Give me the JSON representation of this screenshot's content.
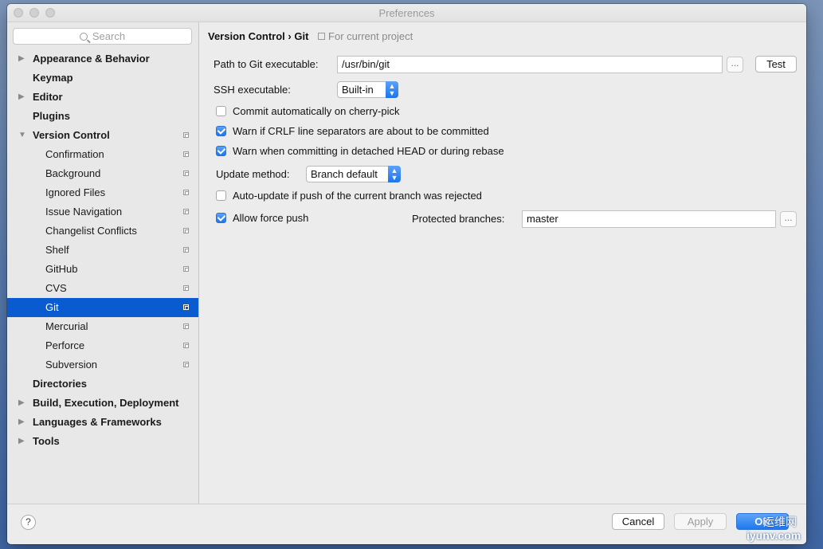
{
  "window": {
    "title": "Preferences"
  },
  "sidebar": {
    "search_placeholder": "Search",
    "items": [
      {
        "label": "Appearance & Behavior",
        "level": 0,
        "arrow": "▶"
      },
      {
        "label": "Keymap",
        "level": 0,
        "arrow": ""
      },
      {
        "label": "Editor",
        "level": 0,
        "arrow": "▶"
      },
      {
        "label": "Plugins",
        "level": 0,
        "arrow": ""
      },
      {
        "label": "Version Control",
        "level": 0,
        "arrow": "▼"
      },
      {
        "label": "Confirmation",
        "level": 1
      },
      {
        "label": "Background",
        "level": 1
      },
      {
        "label": "Ignored Files",
        "level": 1
      },
      {
        "label": "Issue Navigation",
        "level": 1
      },
      {
        "label": "Changelist Conflicts",
        "level": 1
      },
      {
        "label": "Shelf",
        "level": 1
      },
      {
        "label": "GitHub",
        "level": 1
      },
      {
        "label": "CVS",
        "level": 1
      },
      {
        "label": "Git",
        "level": 1,
        "selected": true
      },
      {
        "label": "Mercurial",
        "level": 1
      },
      {
        "label": "Perforce",
        "level": 1
      },
      {
        "label": "Subversion",
        "level": 1
      },
      {
        "label": "Directories",
        "level": 0,
        "arrow": ""
      },
      {
        "label": "Build, Execution, Deployment",
        "level": 0,
        "arrow": "▶"
      },
      {
        "label": "Languages & Frameworks",
        "level": 0,
        "arrow": "▶"
      },
      {
        "label": "Tools",
        "level": 0,
        "arrow": "▶"
      }
    ]
  },
  "breadcrumb": {
    "path": "Version Control › Git",
    "scope": "For current project"
  },
  "git": {
    "path_label": "Path to Git executable:",
    "path_value": "/usr/bin/git",
    "browse": "...",
    "test_button": "Test",
    "ssh_label": "SSH executable:",
    "ssh_value": "Built-in",
    "cb_cherry": "Commit automatically on cherry-pick",
    "cb_cherry_checked": false,
    "cb_crlf": "Warn if CRLF line separators are about to be committed",
    "cb_crlf_checked": true,
    "cb_detached": "Warn when committing in detached HEAD or during rebase",
    "cb_detached_checked": true,
    "update_label": "Update method:",
    "update_value": "Branch default",
    "cb_autoupdate": "Auto-update if push of the current branch was rejected",
    "cb_autoupdate_checked": false,
    "cb_force": "Allow force push",
    "cb_force_checked": true,
    "protected_label": "Protected branches:",
    "protected_value": "master"
  },
  "footer": {
    "help": "?",
    "cancel": "Cancel",
    "apply": "Apply",
    "ok": "OK"
  },
  "watermark": {
    "line1": "运维网",
    "line2": "iyunv.com"
  }
}
